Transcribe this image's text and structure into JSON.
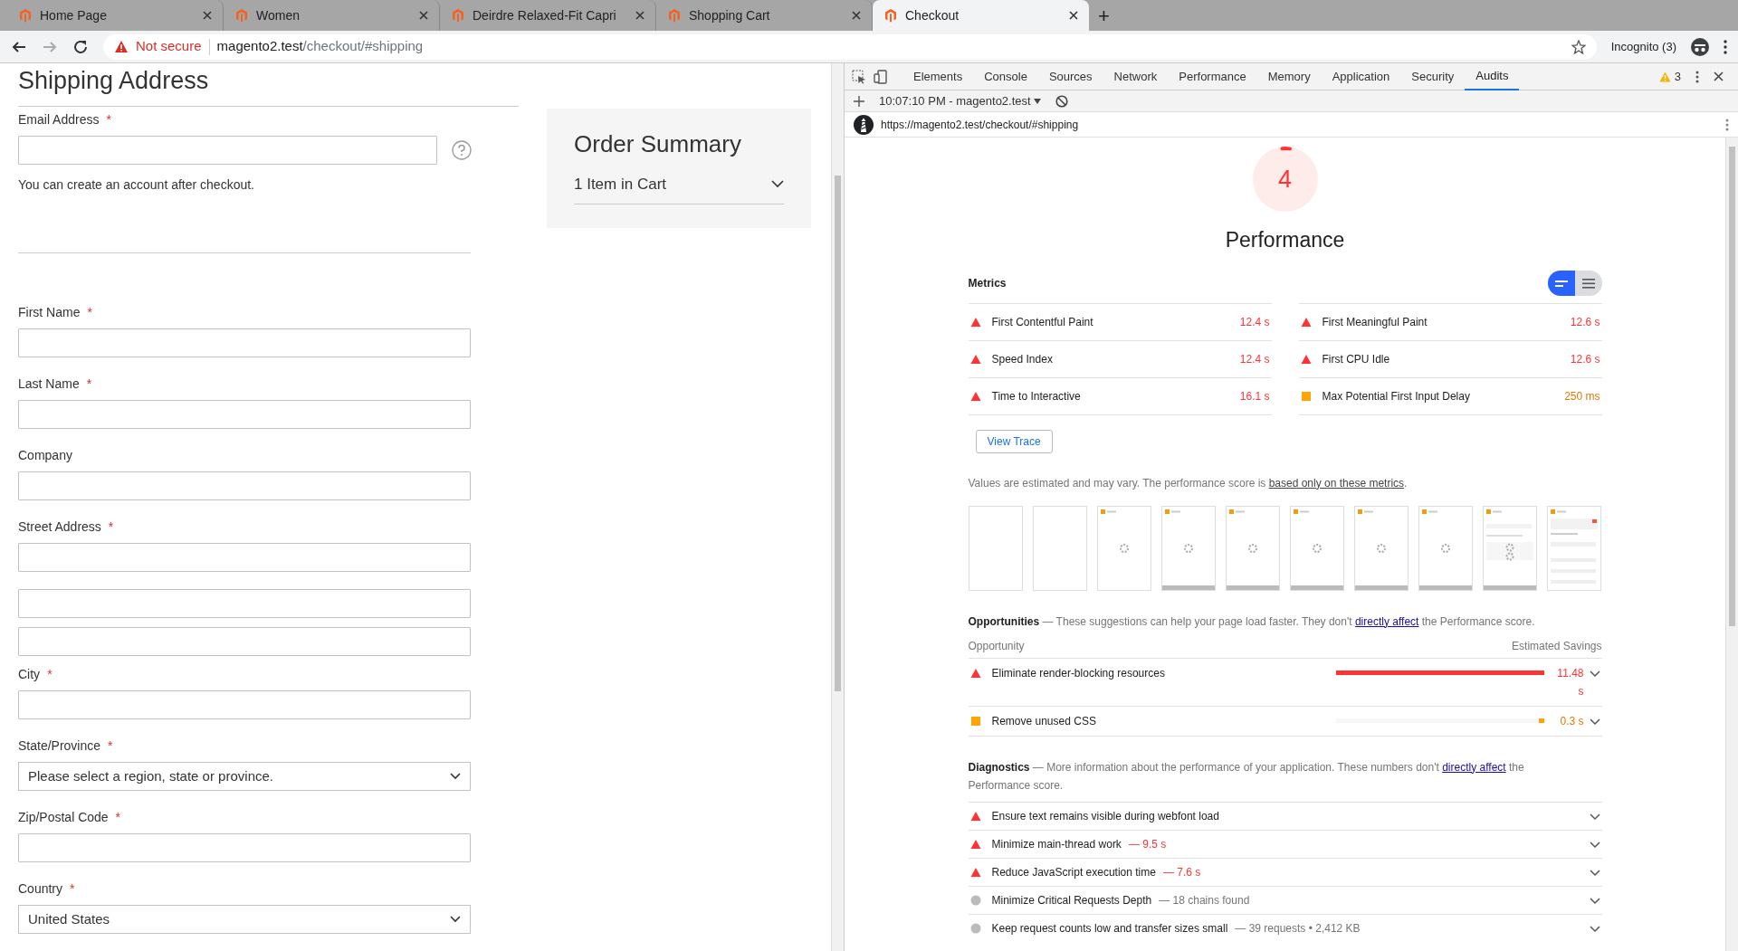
{
  "browser": {
    "tabs": [
      {
        "title": "Home Page",
        "selected": false
      },
      {
        "title": "Women",
        "selected": false
      },
      {
        "title": "Deirdre Relaxed-Fit Capri",
        "selected": false
      },
      {
        "title": "Shopping Cart",
        "selected": false
      },
      {
        "title": "Checkout",
        "selected": true
      }
    ],
    "new_tab": "+",
    "security": "Not secure",
    "url_host": "magento2.test",
    "url_path": "/checkout/#shipping",
    "profile": "Incognito (3)"
  },
  "page": {
    "title": "Shipping Address",
    "fields": [
      {
        "kind": "email",
        "label": "Email Address",
        "asterisk": "*",
        "note": "You can create an account after checkout."
      },
      {
        "kind": "text",
        "label": "First Name",
        "asterisk": "*"
      },
      {
        "kind": "text",
        "label": "Last Name",
        "asterisk": "*"
      },
      {
        "kind": "text",
        "label": "Company"
      },
      {
        "kind": "text",
        "label": "Street Address",
        "asterisk": "*"
      },
      {
        "kind": "text"
      },
      {
        "kind": "text"
      },
      {
        "kind": "text",
        "label": "City",
        "asterisk": "*"
      },
      {
        "kind": "select",
        "label": "State/Province",
        "asterisk": "*",
        "value": "Please select a region, state or province."
      },
      {
        "kind": "text",
        "label": "Zip/Postal Code",
        "asterisk": "*"
      },
      {
        "kind": "select",
        "label": "Country",
        "asterisk": "*",
        "value": "United States"
      }
    ],
    "summary": {
      "title": "Order Summary",
      "items": "1 Item in Cart",
      "expanded": false
    }
  },
  "devtools": {
    "tabs": [
      {
        "label": "Elements",
        "selected": false
      },
      {
        "label": "Console",
        "selected": false
      },
      {
        "label": "Sources",
        "selected": false
      },
      {
        "label": "Network",
        "selected": false
      },
      {
        "label": "Performance",
        "selected": false
      },
      {
        "label": "Memory",
        "selected": false
      },
      {
        "label": "Application",
        "selected": false
      },
      {
        "label": "Security",
        "selected": false
      },
      {
        "label": "Audits",
        "selected": true
      }
    ],
    "warnings": "3",
    "session": "10:07:10 PM - magento2.test",
    "report_url": "https://magento2.test/checkout/#shipping",
    "score": {
      "value": "4",
      "level": 0.04,
      "title": "Performance"
    },
    "metrics": {
      "title": "Metrics",
      "view_toggle": [
        {
          "kind": "compact",
          "selected": true
        },
        {
          "kind": "list",
          "selected": false
        }
      ],
      "items": [
        {
          "name": "First Contentful Paint",
          "value": "12.4 s",
          "kind": "fail"
        },
        {
          "name": "First Meaningful Paint",
          "value": "12.6 s",
          "kind": "fail"
        },
        {
          "name": "Speed Index",
          "value": "12.4 s",
          "kind": "fail"
        },
        {
          "name": "First CPU Idle",
          "value": "12.6 s",
          "kind": "fail"
        },
        {
          "name": "Time to Interactive",
          "value": "16.1 s",
          "kind": "fail"
        },
        {
          "name": "Max Potential First Input Delay",
          "value": "250 ms",
          "kind": "average"
        }
      ]
    },
    "view_trace": "View Trace",
    "note": {
      "before": "Values are estimated and may vary. The performance score is ",
      "link": "based only on these metrics",
      "after": "."
    },
    "filmstrip": [
      {
        "kind": "blank"
      },
      {
        "kind": "blank"
      },
      {
        "kind": "loading"
      },
      {
        "kind": "loading-footer"
      },
      {
        "kind": "loading-footer"
      },
      {
        "kind": "loading-footer"
      },
      {
        "kind": "loading-footer"
      },
      {
        "kind": "loading-footer"
      },
      {
        "kind": "partial"
      },
      {
        "kind": "rendered"
      }
    ],
    "opportunities": {
      "title": "Opportunities",
      "before": "— These suggestions can help your page load faster. They don't ",
      "link": "directly affect",
      "after": " the Performance score.",
      "column_1": "Opportunity",
      "column_2": "Estimated Savings",
      "items": [
        {
          "name": "Eliminate render-blocking resources",
          "savings": "11.48 s",
          "level": 1.0,
          "kind": "fail",
          "expanded": false
        },
        {
          "name": "Remove unused CSS",
          "savings": "0.3 s",
          "level": 0.026,
          "kind": "average",
          "expanded": false
        }
      ]
    },
    "diagnostics": {
      "title": "Diagnostics",
      "before": "— More information about the performance of your application. These numbers don't ",
      "link": "directly affect",
      "after": " the Performance score.",
      "items": [
        {
          "name": "Ensure text remains visible during webfont load",
          "kind": "fail",
          "expanded": false
        },
        {
          "name": "Minimize main-thread work",
          "detail": "— 9.5 s",
          "kind": "fail",
          "expanded": false
        },
        {
          "name": "Reduce JavaScript execution time",
          "detail": "— 7.6 s",
          "kind": "fail",
          "expanded": false
        },
        {
          "name": "Minimize Critical Requests Depth",
          "detail": "— 18 chains found",
          "kind": "info",
          "expanded": false
        },
        {
          "name": "Keep request counts low and transfer sizes small",
          "detail": "— 39 requests • 2,412 KB",
          "kind": "info",
          "expanded": false
        }
      ]
    }
  }
}
